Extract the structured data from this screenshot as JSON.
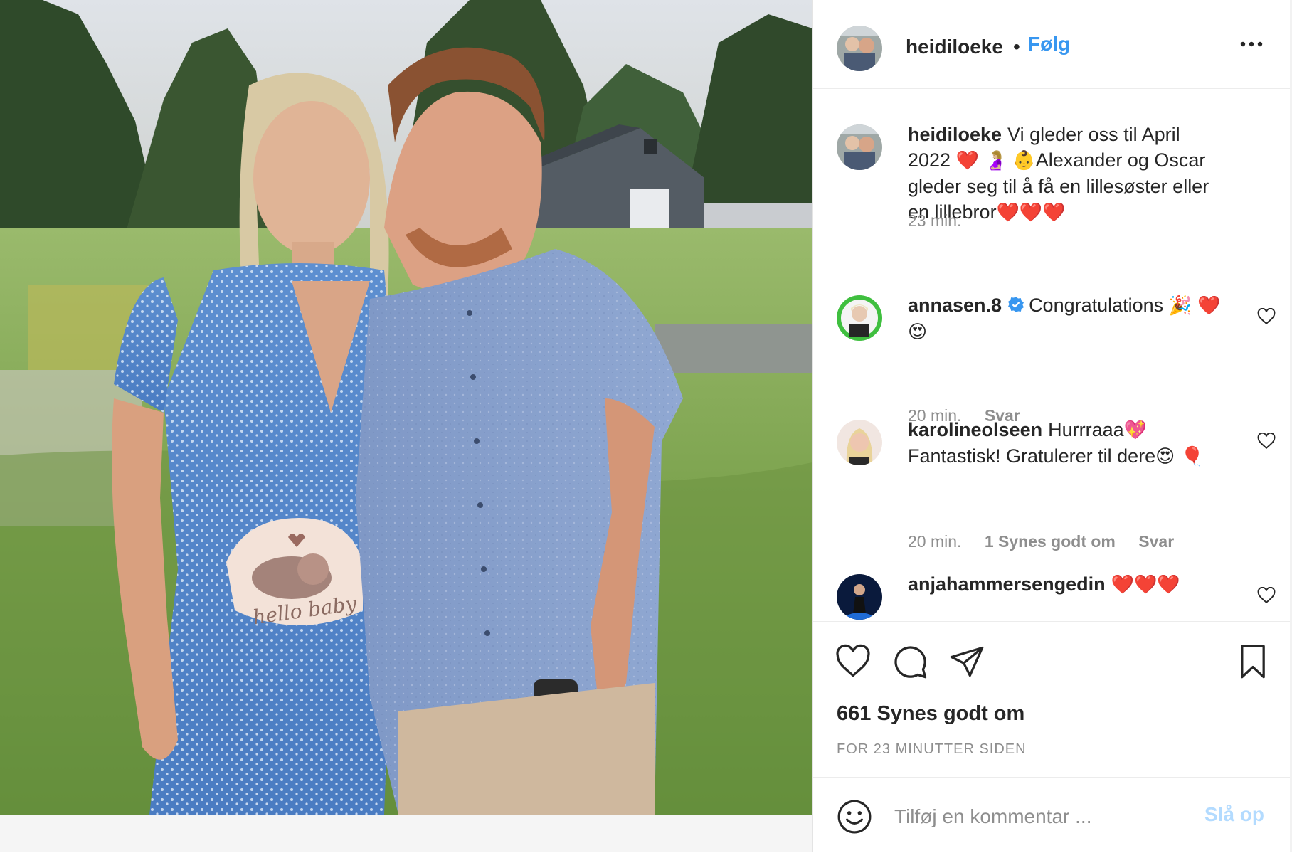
{
  "post": {
    "author": "heidiloeke",
    "follow_label": "Følg",
    "separator": "•",
    "image": {
      "sticker_text": "hello baby"
    }
  },
  "caption": {
    "username": "heidiloeke",
    "text_before": "Vi gleder oss til April 2022",
    "emoji_1": "❤️",
    "emoji_2": "🤰🏼",
    "emoji_3": "👶",
    "text_after": "Alexander og Oscar gleder seg til å få en lillesøster eller en lillebror",
    "emoji_end": "❤️❤️❤️",
    "time": "23 min."
  },
  "comments": [
    {
      "username": "annasen.8",
      "verified": true,
      "text": "Congratulations",
      "emoji": "🎉 ❤️ 😍",
      "time": "20 min.",
      "reply_label": "Svar"
    },
    {
      "username": "karolineolseen",
      "text_1": "Hurrraaa",
      "emoji_1": "💖",
      "text_2": "Fantastisk! Gratulerer til dere",
      "emoji_2": "😍 🎈",
      "time": "20 min.",
      "likes": "1 Synes godt om",
      "reply_label": "Svar"
    },
    {
      "username": "anjahammersengedin",
      "emoji": "❤️❤️❤️"
    }
  ],
  "engagement": {
    "likes": "661 Synes godt om",
    "timestamp": "FOR 23 MINUTTER SIDEN"
  },
  "add_comment": {
    "placeholder": "Tilføj en kommentar ...",
    "post_label": "Slå op"
  },
  "colors": {
    "link_blue": "#3897f0",
    "post_disabled": "#b3dbff",
    "muted": "#8e8e8e",
    "text": "#262626"
  },
  "icons": {
    "more": "more-horizontal-icon",
    "like": "heart-outline-icon",
    "comment": "comment-bubble-icon",
    "share": "paper-plane-icon",
    "save": "bookmark-icon",
    "emoji": "smiley-icon",
    "verified": "verified-badge-icon"
  }
}
